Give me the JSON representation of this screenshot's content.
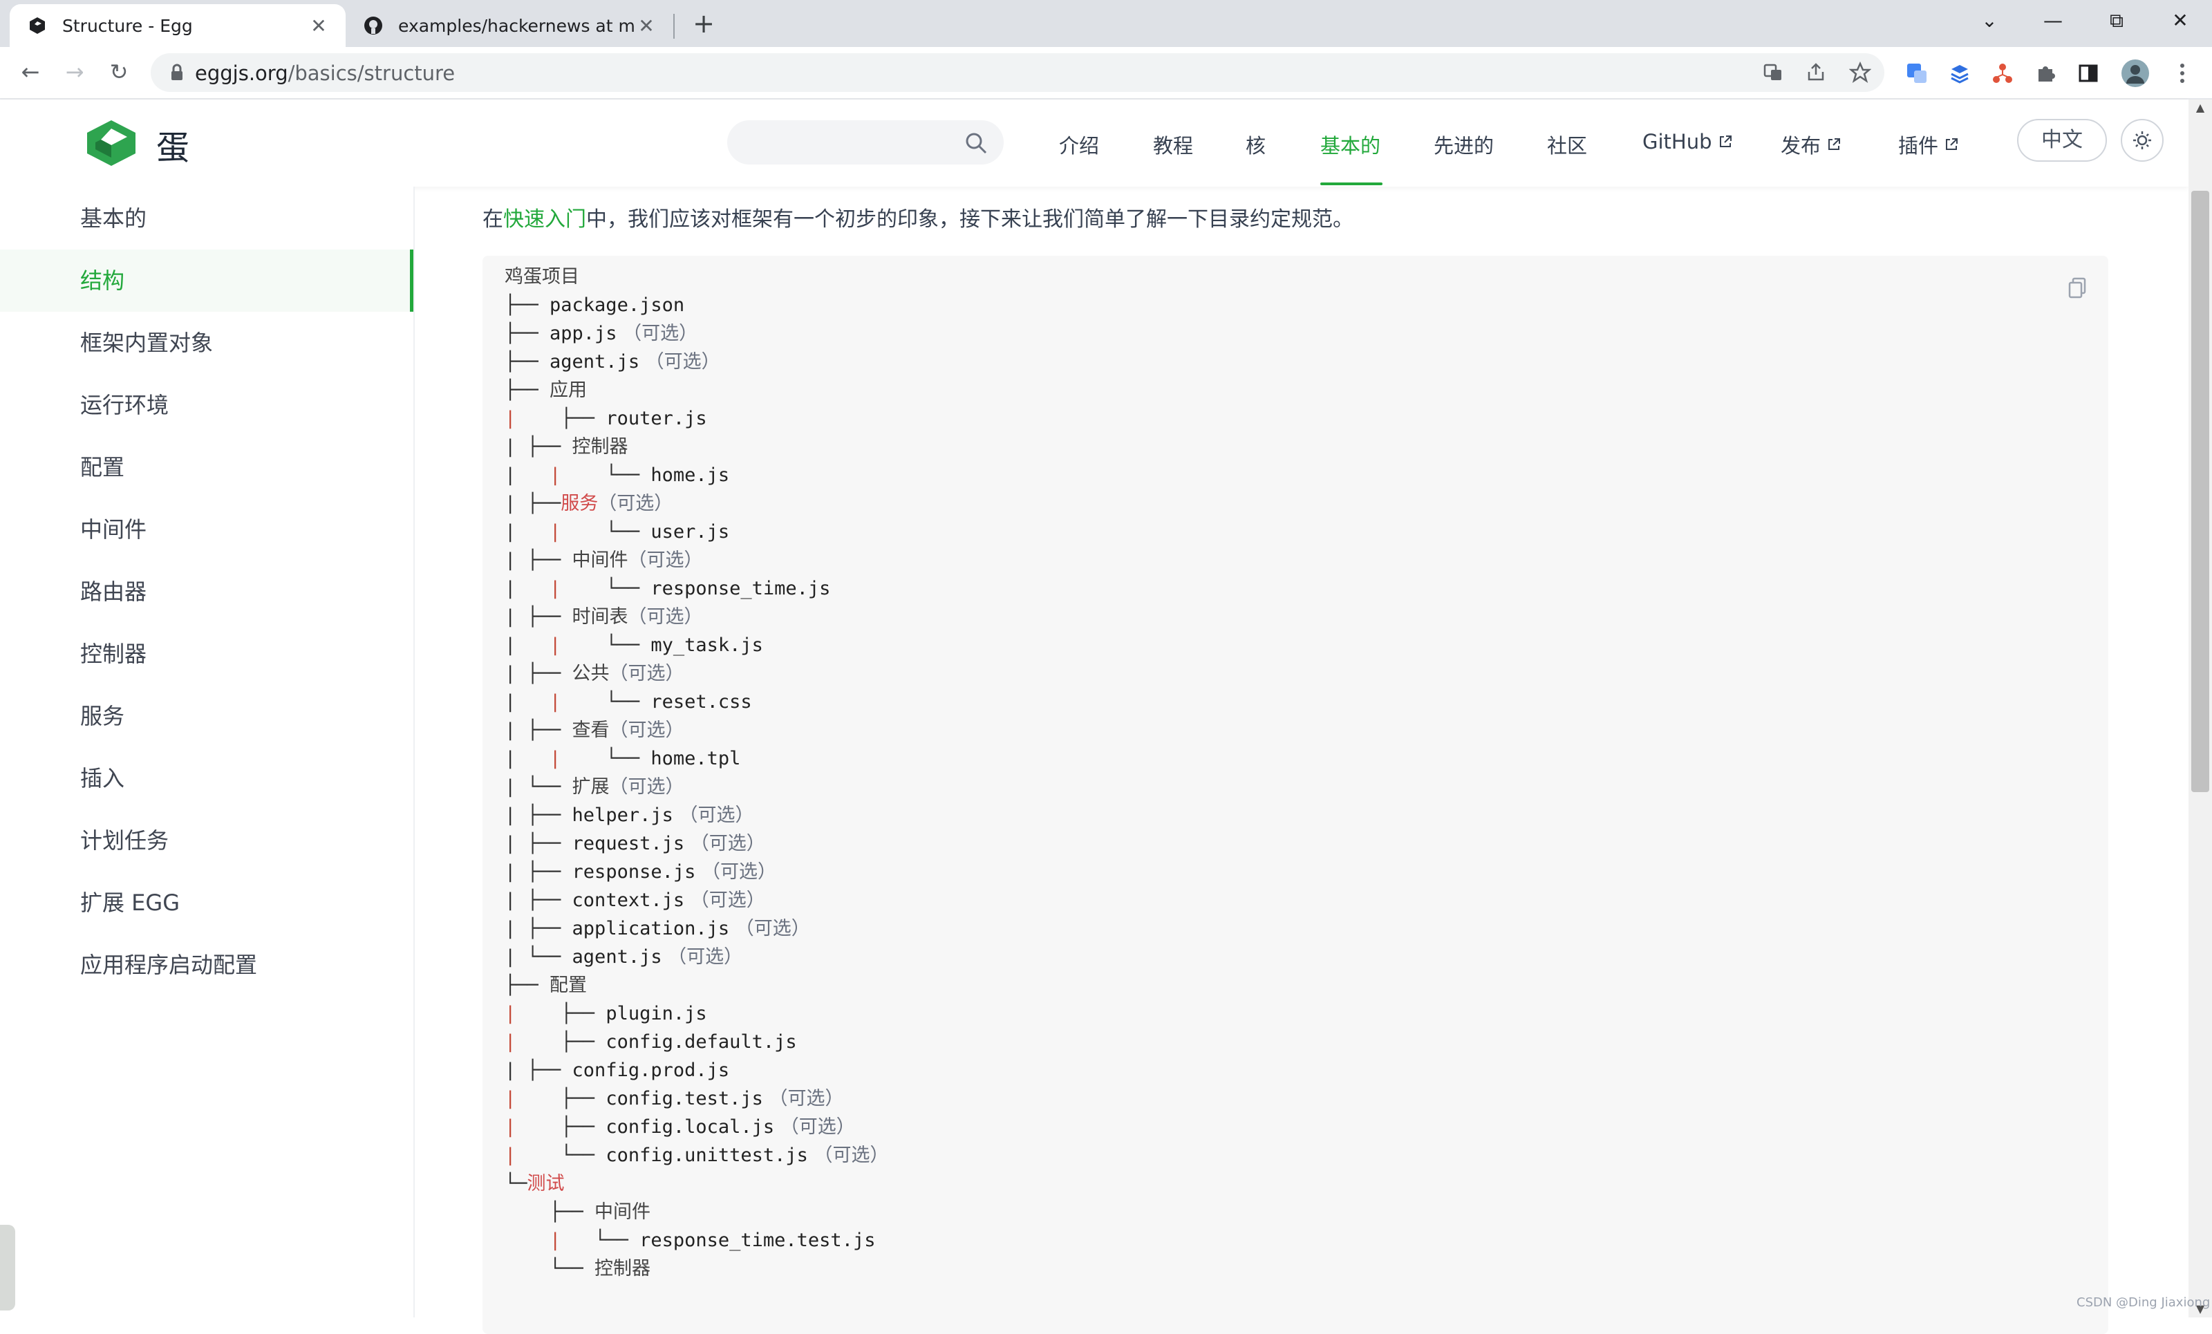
{
  "browser": {
    "tabs": [
      {
        "title": "Structure - Egg",
        "active": true
      },
      {
        "title": "examples/hackernews at mast•",
        "active": false
      }
    ],
    "new_tab_label": "+",
    "url_host": "eggjs.org",
    "url_path": "/basics/structure",
    "window_controls": {
      "chevron": "⌄",
      "minimize": "—",
      "restore": "⧉",
      "close": "✕"
    }
  },
  "site": {
    "brand": "蛋",
    "nav": [
      {
        "label": "介绍",
        "active": false,
        "external": false
      },
      {
        "label": "教程",
        "active": false,
        "external": false
      },
      {
        "label": "核",
        "active": false,
        "external": false
      },
      {
        "label": "基本的",
        "active": true,
        "external": false
      },
      {
        "label": "先进的",
        "active": false,
        "external": false
      },
      {
        "label": "社区",
        "active": false,
        "external": false
      },
      {
        "label": "GitHub",
        "active": false,
        "external": true
      },
      {
        "label": "发布",
        "active": false,
        "external": true
      },
      {
        "label": "插件",
        "active": false,
        "external": true
      }
    ],
    "lang_button": "中文",
    "accent_color": "#22a83b"
  },
  "sidebar": {
    "items": [
      {
        "label": "基本的",
        "active": false
      },
      {
        "label": "结构",
        "active": true
      },
      {
        "label": "框架内置对象",
        "active": false
      },
      {
        "label": "运行环境",
        "active": false
      },
      {
        "label": "配置",
        "active": false
      },
      {
        "label": "中间件",
        "active": false
      },
      {
        "label": "路由器",
        "active": false
      },
      {
        "label": "控制器",
        "active": false
      },
      {
        "label": "服务",
        "active": false
      },
      {
        "label": "插入",
        "active": false
      },
      {
        "label": "计划任务",
        "active": false
      },
      {
        "label": "扩展 EGG",
        "active": false
      },
      {
        "label": "应用程序启动配置",
        "active": false
      }
    ]
  },
  "main": {
    "intro_before": "在",
    "intro_link": "快速入门",
    "intro_after": "中，我们应该对框架有一个初步的印象，接下来让我们简单了解一下目录约定规范。",
    "code_lines": [
      [
        {
          "t": "鸡蛋项目",
          "c": "cjk"
        }
      ],
      [
        {
          "t": "├── ",
          "c": "branch"
        },
        {
          "t": "package.json",
          "c": "name"
        }
      ],
      [
        {
          "t": "├── ",
          "c": "branch"
        },
        {
          "t": "app.js",
          "c": "name"
        },
        {
          "t": " （可选）",
          "c": "opt"
        }
      ],
      [
        {
          "t": "├── ",
          "c": "branch"
        },
        {
          "t": "agent.js",
          "c": "name"
        },
        {
          "t": " （可选）",
          "c": "opt"
        }
      ],
      [
        {
          "t": "├── ",
          "c": "branch"
        },
        {
          "t": "应用",
          "c": "cjk"
        }
      ],
      [
        {
          "t": "|",
          "c": "bar-red"
        },
        {
          "t": "    ├── ",
          "c": "branch"
        },
        {
          "t": "router.js",
          "c": "name"
        }
      ],
      [
        {
          "t": "| ├── ",
          "c": "branch"
        },
        {
          "t": "控制器",
          "c": "cjk"
        }
      ],
      [
        {
          "t": "| ",
          "c": "branch"
        },
        {
          "t": "  |",
          "c": "bar-red"
        },
        {
          "t": "    └── ",
          "c": "branch"
        },
        {
          "t": "home.js",
          "c": "name"
        }
      ],
      [
        {
          "t": "| ├──",
          "c": "branch"
        },
        {
          "t": "服务",
          "c": "red"
        },
        {
          "t": "（可选）",
          "c": "opt"
        }
      ],
      [
        {
          "t": "| ",
          "c": "branch"
        },
        {
          "t": "  |",
          "c": "bar-red"
        },
        {
          "t": "    └── ",
          "c": "branch"
        },
        {
          "t": "user.js",
          "c": "name"
        }
      ],
      [
        {
          "t": "| ├── ",
          "c": "branch"
        },
        {
          "t": "中间件",
          "c": "cjk"
        },
        {
          "t": "（可选）",
          "c": "opt"
        }
      ],
      [
        {
          "t": "| ",
          "c": "branch"
        },
        {
          "t": "  |",
          "c": "bar-red"
        },
        {
          "t": "    └── ",
          "c": "branch"
        },
        {
          "t": "response_time.js",
          "c": "name"
        }
      ],
      [
        {
          "t": "| ├── ",
          "c": "branch"
        },
        {
          "t": "时间表",
          "c": "cjk"
        },
        {
          "t": "（可选）",
          "c": "opt"
        }
      ],
      [
        {
          "t": "| ",
          "c": "branch"
        },
        {
          "t": "  |",
          "c": "bar-red"
        },
        {
          "t": "    └── ",
          "c": "branch"
        },
        {
          "t": "my_task.js",
          "c": "name"
        }
      ],
      [
        {
          "t": "| ├── ",
          "c": "branch"
        },
        {
          "t": "公共",
          "c": "cjk"
        },
        {
          "t": "（可选）",
          "c": "opt"
        }
      ],
      [
        {
          "t": "| ",
          "c": "branch"
        },
        {
          "t": "  |",
          "c": "bar-red"
        },
        {
          "t": "    └── ",
          "c": "branch"
        },
        {
          "t": "reset.css",
          "c": "name"
        }
      ],
      [
        {
          "t": "| ├── ",
          "c": "branch"
        },
        {
          "t": "查看",
          "c": "cjk"
        },
        {
          "t": "（可选）",
          "c": "opt"
        }
      ],
      [
        {
          "t": "| ",
          "c": "branch"
        },
        {
          "t": "  |",
          "c": "bar-red"
        },
        {
          "t": "    └── ",
          "c": "branch"
        },
        {
          "t": "home.tpl",
          "c": "name"
        }
      ],
      [
        {
          "t": "| └── ",
          "c": "branch"
        },
        {
          "t": "扩展",
          "c": "cjk"
        },
        {
          "t": "（可选）",
          "c": "opt"
        }
      ],
      [
        {
          "t": "| ├── ",
          "c": "branch"
        },
        {
          "t": "helper.js",
          "c": "name"
        },
        {
          "t": " （可选）",
          "c": "opt"
        }
      ],
      [
        {
          "t": "| ├── ",
          "c": "branch"
        },
        {
          "t": "request.js",
          "c": "name"
        },
        {
          "t": " （可选）",
          "c": "opt"
        }
      ],
      [
        {
          "t": "| ├── ",
          "c": "branch"
        },
        {
          "t": "response.js",
          "c": "name"
        },
        {
          "t": " （可选）",
          "c": "opt"
        }
      ],
      [
        {
          "t": "| ├── ",
          "c": "branch"
        },
        {
          "t": "context.js",
          "c": "name"
        },
        {
          "t": " （可选）",
          "c": "opt"
        }
      ],
      [
        {
          "t": "| ├── ",
          "c": "branch"
        },
        {
          "t": "application.js",
          "c": "name"
        },
        {
          "t": " （可选）",
          "c": "opt"
        }
      ],
      [
        {
          "t": "| └── ",
          "c": "branch"
        },
        {
          "t": "agent.js",
          "c": "name"
        },
        {
          "t": " （可选）",
          "c": "opt"
        }
      ],
      [
        {
          "t": "├── ",
          "c": "branch"
        },
        {
          "t": "配置",
          "c": "cjk"
        }
      ],
      [
        {
          "t": "|",
          "c": "bar-red"
        },
        {
          "t": "    ├── ",
          "c": "branch"
        },
        {
          "t": "plugin.js",
          "c": "name"
        }
      ],
      [
        {
          "t": "|",
          "c": "bar-red"
        },
        {
          "t": "    ├── ",
          "c": "branch"
        },
        {
          "t": "config.default.js",
          "c": "name"
        }
      ],
      [
        {
          "t": "| ├── ",
          "c": "branch"
        },
        {
          "t": "config.prod.js",
          "c": "name"
        }
      ],
      [
        {
          "t": "|",
          "c": "bar-red"
        },
        {
          "t": "    ├── ",
          "c": "branch"
        },
        {
          "t": "config.test.js",
          "c": "name"
        },
        {
          "t": " （可选）",
          "c": "opt"
        }
      ],
      [
        {
          "t": "|",
          "c": "bar-red"
        },
        {
          "t": "    ├── ",
          "c": "branch"
        },
        {
          "t": "config.local.js",
          "c": "name"
        },
        {
          "t": " （可选）",
          "c": "opt"
        }
      ],
      [
        {
          "t": "|",
          "c": "bar-red"
        },
        {
          "t": "    └── ",
          "c": "branch"
        },
        {
          "t": "config.unittest.js",
          "c": "name"
        },
        {
          "t": " （可选）",
          "c": "opt"
        }
      ],
      [
        {
          "t": "└─",
          "c": "branch"
        },
        {
          "t": "测试",
          "c": "red"
        }
      ],
      [
        {
          "t": "    ├── ",
          "c": "branch"
        },
        {
          "t": "中间件",
          "c": "cjk"
        }
      ],
      [
        {
          "t": "    ",
          "c": "branch"
        },
        {
          "t": "|",
          "c": "bar-red"
        },
        {
          "t": "   └── ",
          "c": "branch"
        },
        {
          "t": "response_time.test.js",
          "c": "name"
        }
      ],
      [
        {
          "t": "    └── ",
          "c": "branch"
        },
        {
          "t": "控制器",
          "c": "cjk"
        }
      ]
    ]
  },
  "watermark": "CSDN @Ding Jiaxiong"
}
